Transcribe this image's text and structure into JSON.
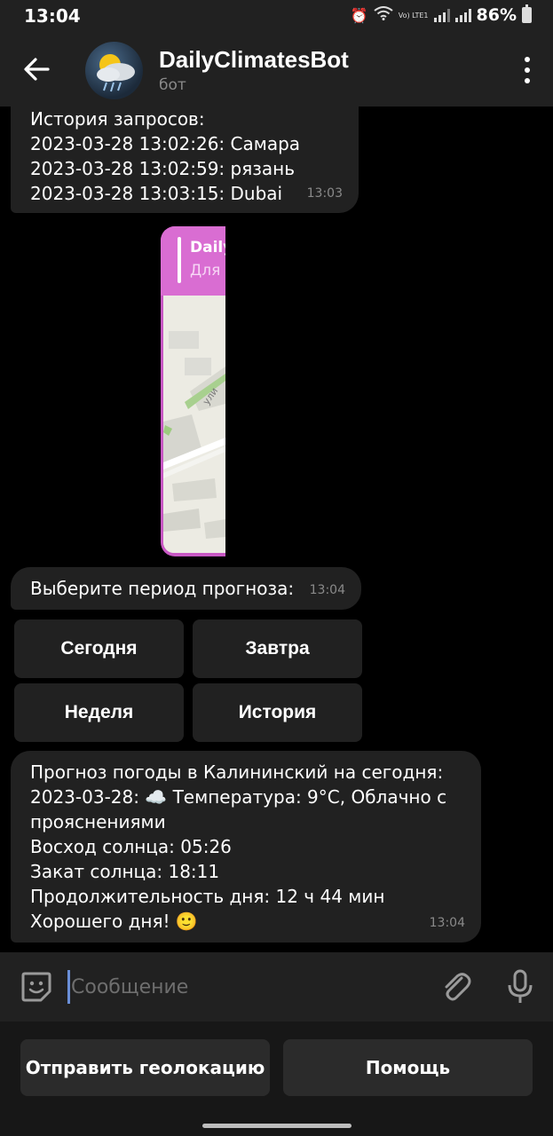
{
  "status_bar": {
    "time": "13:04",
    "network_label": "Vo) LTE1",
    "battery": "86%"
  },
  "header": {
    "title": "DailyClimatesBot",
    "subtitle": "бот",
    "icons": [
      "back-arrow-icon",
      "bot-avatar",
      "more-vert-icon"
    ]
  },
  "messages": {
    "history": {
      "lines": [
        "История запросов:",
        "2023-03-28 13:02:26: Самара",
        "2023-03-28 13:02:59: рязань",
        "2023-03-28 13:03:15: Dubai"
      ],
      "time": "13:03"
    },
    "map_card": {
      "title": "Daily",
      "subtitle": "Для",
      "map_street": "ули"
    },
    "period": {
      "text": "Выберите период прогноза:",
      "time": "13:04"
    },
    "inline_keyboard": {
      "today": "Сегодня",
      "tomorrow": "Завтра",
      "week": "Неделя",
      "history": "История"
    },
    "forecast": {
      "lines": [
        "Прогноз погоды в Калининский на сегодня:",
        "2023-03-28: ☁️ Температура: 9°C, Облачно с",
        "прояснениями",
        "Восход солнца: 05:26",
        "Закат солнца: 18:11",
        "Продолжительность дня: 12 ч 44 мин",
        "Хорошего дня! 🙂"
      ],
      "time": "13:04"
    }
  },
  "input": {
    "placeholder": "Сообщение"
  },
  "reply_keyboard": {
    "send_location": "Отправить геолокацию",
    "help": "Помощь"
  },
  "colors": {
    "background": "#000000",
    "bubble": "#212121",
    "bar": "#212121",
    "map_card_accent": "#d96dd2",
    "caret": "#6a8fd8"
  }
}
